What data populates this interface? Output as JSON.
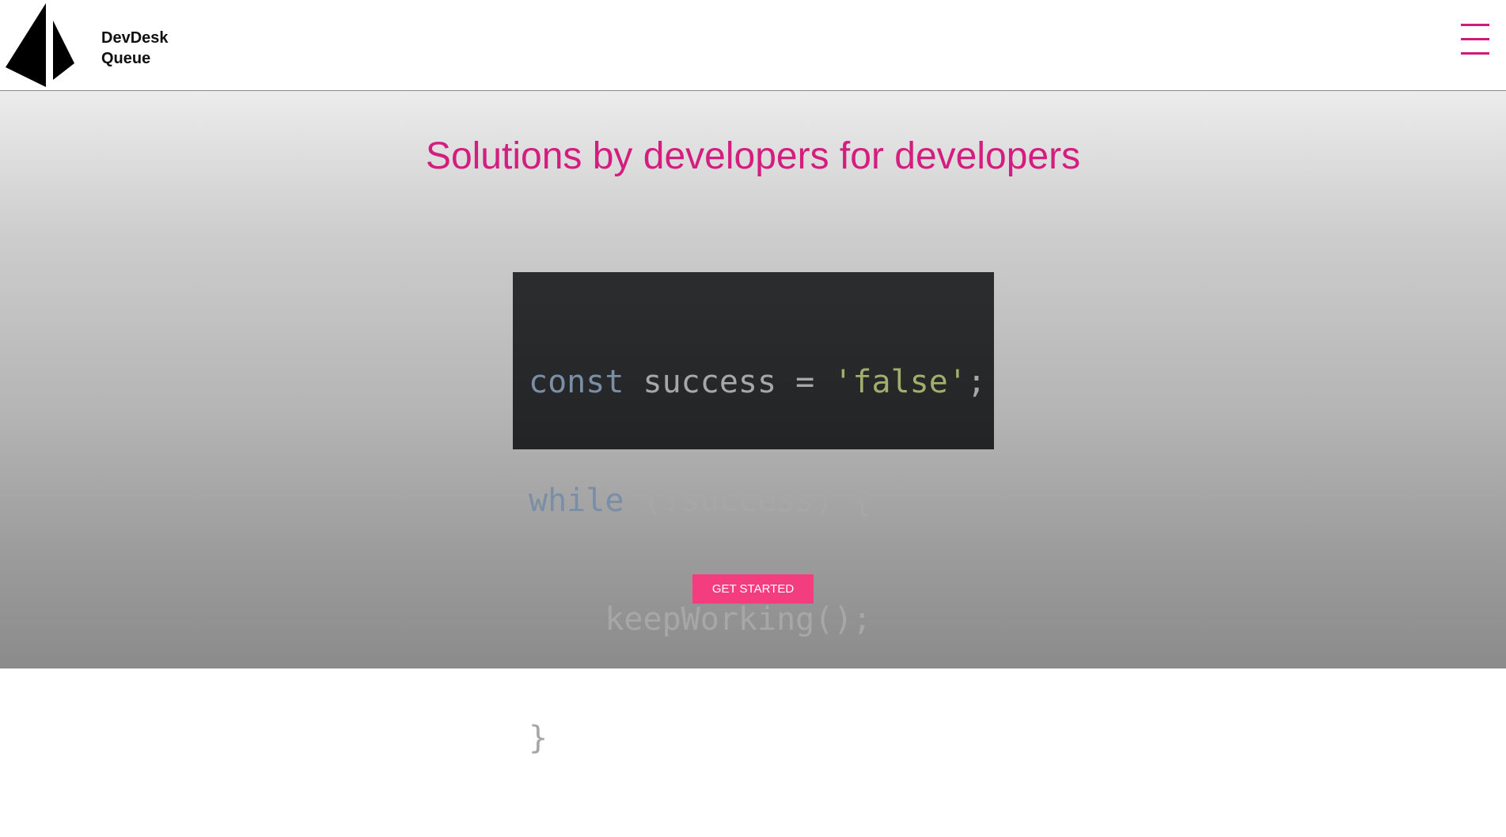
{
  "header": {
    "brand_line1": "DevDesk",
    "brand_line2": "Queue",
    "logo_icon": "sail-logo-icon",
    "menu_icon": "hamburger-menu-icon",
    "accent_color": "#d0197b"
  },
  "hero": {
    "title": "Solutions by developers for developers",
    "title_color": "#d41d7f",
    "code": {
      "line1": {
        "keyword": "const",
        "rest": " success = ",
        "string": "'false'",
        "end": ";"
      },
      "line2": {
        "keyword": "while",
        "rest": " (!success) {"
      },
      "line3": {
        "text": "    keepWorking();"
      },
      "line4": {
        "text": "}"
      }
    },
    "cta_label": "GET STARTED",
    "cta_color": "#f43d7f"
  }
}
